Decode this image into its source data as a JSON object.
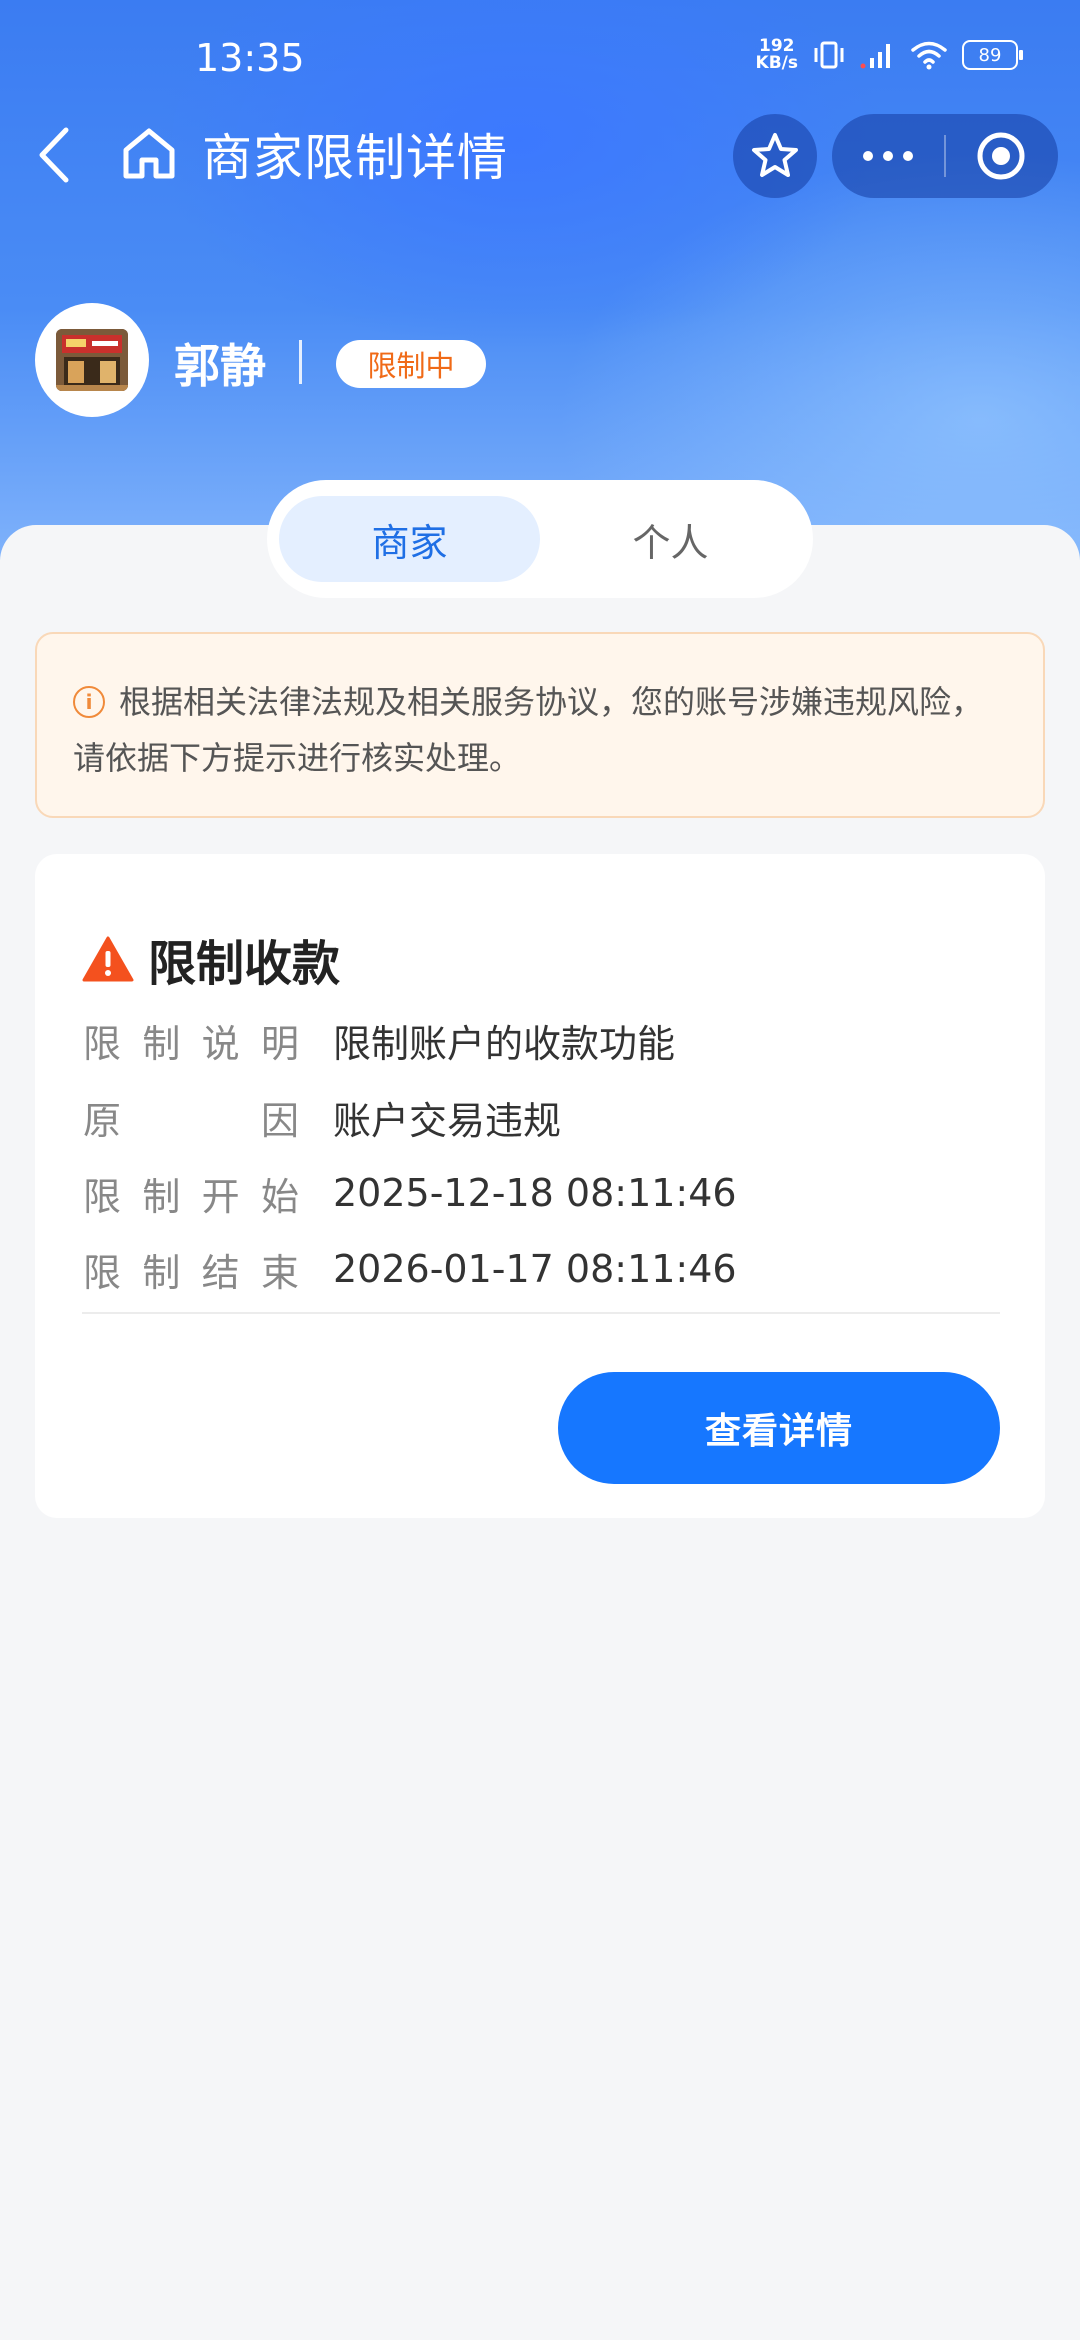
{
  "status_bar": {
    "time": "13:35",
    "net_speed_value": "192",
    "net_speed_unit": "KB/s",
    "battery": "89"
  },
  "nav": {
    "title": "商家限制详情"
  },
  "profile": {
    "name": "郭静",
    "status_badge": "限制中"
  },
  "tabs": [
    {
      "label": "商家",
      "active": true
    },
    {
      "label": "个人",
      "active": false
    }
  ],
  "notice": {
    "text": "根据相关法律法规及相关服务协议，您的账号涉嫌违规风险，请依据下方提示进行核实处理。"
  },
  "restriction_card": {
    "title": "限制收款",
    "rows": [
      {
        "label": "限制说明",
        "value": "限制账户的收款功能"
      },
      {
        "label": "原因",
        "value": "账户交易违规"
      },
      {
        "label": "限制开始",
        "value": "2025-12-18 08:11:46"
      },
      {
        "label": "限制结束",
        "value": "2026-01-17 08:11:46"
      }
    ],
    "detail_button": "查看详情"
  },
  "colors": {
    "primary": "#1677ff",
    "warning": "#f06a17",
    "notice_bg": "#fff6ec"
  }
}
